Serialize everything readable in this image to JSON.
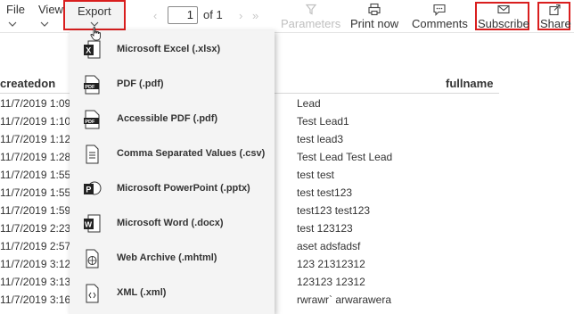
{
  "toolbar": {
    "file": "File",
    "view": "View",
    "export": "Export",
    "page_value": "1",
    "page_of": "of 1",
    "parameters": "Parameters",
    "print_now": "Print now",
    "comments": "Comments",
    "subscribe": "Subscribe",
    "share": "Share",
    "highlight_color": "#d91e1e"
  },
  "export_menu": {
    "items": [
      {
        "label": "Microsoft Excel (.xlsx)",
        "icon": "excel-icon"
      },
      {
        "label": "PDF (.pdf)",
        "icon": "pdf-icon"
      },
      {
        "label": "Accessible PDF (.pdf)",
        "icon": "accessible-pdf-icon"
      },
      {
        "label": "Comma Separated Values (.csv)",
        "icon": "csv-icon"
      },
      {
        "label": "Microsoft PowerPoint (.pptx)",
        "icon": "powerpoint-icon"
      },
      {
        "label": "Microsoft Word (.docx)",
        "icon": "word-icon"
      },
      {
        "label": "Web Archive (.mhtml)",
        "icon": "web-archive-icon"
      },
      {
        "label": "XML (.xml)",
        "icon": "xml-icon"
      }
    ]
  },
  "report": {
    "columns": [
      "createdon",
      "fullname"
    ],
    "rows": [
      {
        "createdon": "11/7/2019 1:09:",
        "fullname": "Lead"
      },
      {
        "createdon": "11/7/2019 1:10:",
        "fullname": "Test Lead1"
      },
      {
        "createdon": "11/7/2019 1:12:",
        "fullname": "test lead3"
      },
      {
        "createdon": "11/7/2019 1:28:",
        "fullname": "Test Lead Test Lead"
      },
      {
        "createdon": "11/7/2019 1:55:",
        "fullname": "test test"
      },
      {
        "createdon": "11/7/2019 1:55:",
        "fullname": "test test123"
      },
      {
        "createdon": "11/7/2019 1:59:",
        "fullname": "test123 test123"
      },
      {
        "createdon": "11/7/2019 2:23:",
        "fullname": "test 123123"
      },
      {
        "createdon": "11/7/2019 2:57:",
        "fullname": "aset adsfadsf"
      },
      {
        "createdon": "11/7/2019 3:12:",
        "fullname": "123 21312312"
      },
      {
        "createdon": "11/7/2019 3:13:",
        "fullname": "123123 12312"
      },
      {
        "createdon": "11/7/2019 3:16:",
        "fullname": "rwrawr` arwarawera"
      }
    ]
  }
}
